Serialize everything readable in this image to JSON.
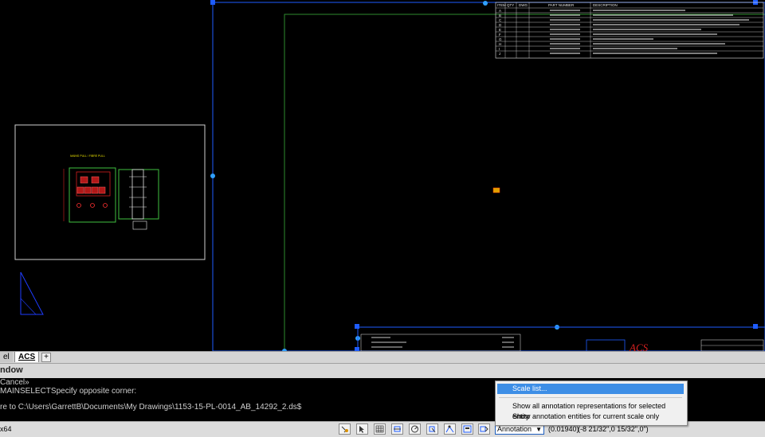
{
  "layout_tabs": {
    "model": "el",
    "acs": "ACS",
    "add": "+"
  },
  "command_window": {
    "title": "ndow",
    "lines": [
      "Cancel»",
      "MAINSELECTSpecify opposite corner:",
      "",
      "re to C:\\Users\\GarrettB\\Documents\\My Drawings\\1153-15-PL-0014_AB_14292_2.ds$"
    ]
  },
  "status_bar": {
    "left_text": "x64",
    "annotation_label": "Annotation",
    "annotation_scale": "(0.01940)",
    "coordinates": "(-8 21/32\",0 15/32\",0\")"
  },
  "context_menu": {
    "items": [
      "Scale list...",
      "Show all annotation representations for selected entity",
      "Show annotation entities for current scale only"
    ]
  },
  "drawing": {
    "panel_title": "MAINS PULL / FIBRE PULL",
    "title_block_company": "ACS",
    "parts_table_headers": [
      "ITEM",
      "QTY",
      "DWG",
      "PART NUMBER",
      "DESCRIPTION"
    ],
    "parts_table_items": [
      "A",
      "B",
      "C",
      "D",
      "E",
      "F",
      "G",
      "H",
      "I",
      "J"
    ],
    "colors": {
      "model_space": "#000000",
      "sheet_border": "#2e8b2e",
      "selection_grip": "#1e5cff",
      "title_red": "#d42020",
      "table_white": "#e8e8e8",
      "panel_green": "#3fbf3f"
    }
  }
}
